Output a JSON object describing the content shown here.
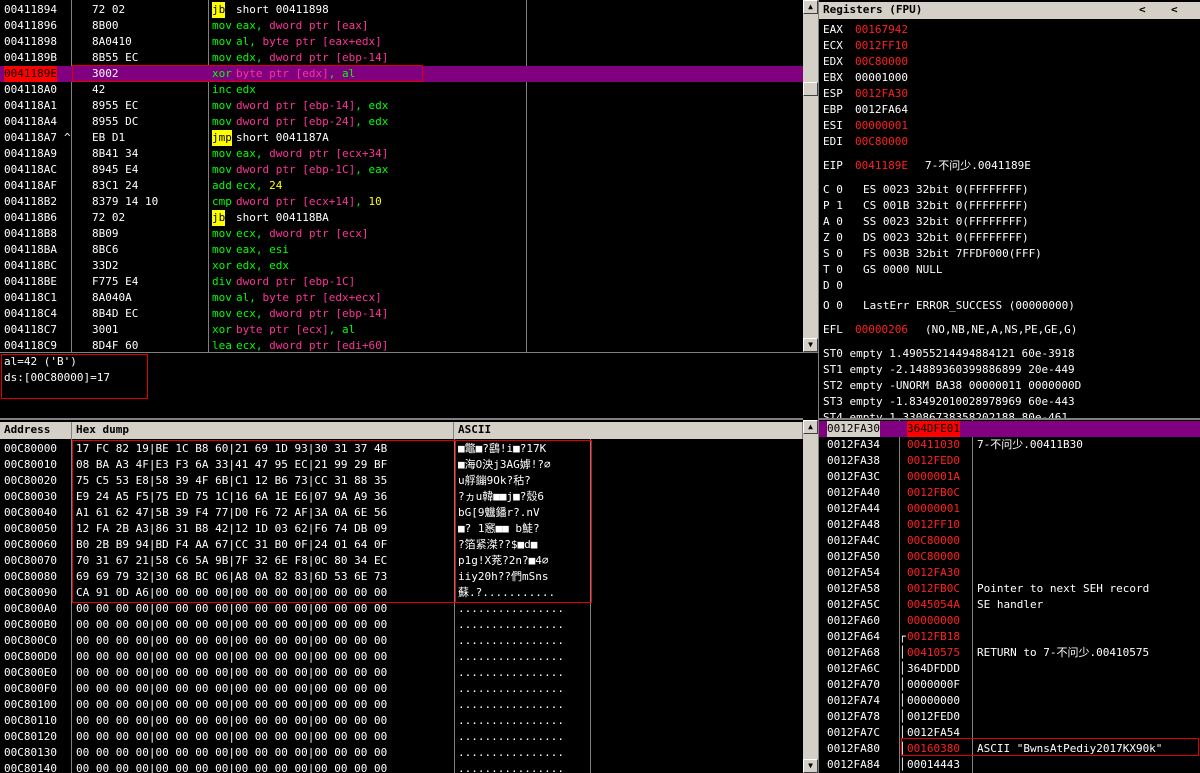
{
  "colors": {
    "background": "#000000",
    "text": "#ffffff",
    "mnemonic": "#00ff00",
    "pointer": "#ff3399",
    "highlight": "#800080",
    "changed": "#ff2020",
    "box": "#e00000"
  },
  "disasm": {
    "rows": [
      {
        "addr": "00411894",
        "mk": " ",
        "bytes": "72 02",
        "mn": "jb",
        "ops": [
          {
            "t": "short 00411898",
            "c": "w"
          }
        ]
      },
      {
        "addr": "00411896",
        "mk": " ",
        "bytes": "8B00",
        "mn": "mov",
        "ops": [
          {
            "t": "eax, ",
            "c": "g"
          },
          {
            "t": "dword ptr [eax]",
            "c": "p"
          }
        ]
      },
      {
        "addr": "00411898",
        "mk": " ",
        "bytes": "8A0410",
        "mn": "mov",
        "ops": [
          {
            "t": "al, ",
            "c": "g"
          },
          {
            "t": "byte ptr [eax+edx]",
            "c": "p"
          }
        ]
      },
      {
        "addr": "0041189B",
        "mk": " ",
        "bytes": "8B55 EC",
        "mn": "mov",
        "ops": [
          {
            "t": "edx, ",
            "c": "g"
          },
          {
            "t": "dword ptr [ebp-14]",
            "c": "p"
          }
        ]
      },
      {
        "addr": "0041189E",
        "mk": " ",
        "bytes": "3002",
        "mn": "xor",
        "ops": [
          {
            "t": "byte ptr [edx]",
            "c": "p"
          },
          {
            "t": ", al",
            "c": "g"
          }
        ]
      },
      {
        "addr": "004118A0",
        "mk": " ",
        "bytes": "42",
        "mn": "inc",
        "ops": [
          {
            "t": "edx",
            "c": "g"
          }
        ]
      },
      {
        "addr": "004118A1",
        "mk": " ",
        "bytes": "8955 EC",
        "mn": "mov",
        "ops": [
          {
            "t": "dword ptr [ebp-14]",
            "c": "p"
          },
          {
            "t": ", edx",
            "c": "g"
          }
        ]
      },
      {
        "addr": "004118A4",
        "mk": " ",
        "bytes": "8955 DC",
        "mn": "mov",
        "ops": [
          {
            "t": "dword ptr [ebp-24]",
            "c": "p"
          },
          {
            "t": ", edx",
            "c": "g"
          }
        ]
      },
      {
        "addr": "004118A7",
        "mk": "^",
        "bytes": "EB D1",
        "mn": "jmp",
        "ops": [
          {
            "t": "short 0041187A",
            "c": "w"
          }
        ]
      },
      {
        "addr": "004118A9",
        "mk": " ",
        "bytes": "8B41 34",
        "mn": "mov",
        "ops": [
          {
            "t": "eax, ",
            "c": "g"
          },
          {
            "t": "dword ptr [ecx+34]",
            "c": "p"
          }
        ]
      },
      {
        "addr": "004118AC",
        "mk": " ",
        "bytes": "8945 E4",
        "mn": "mov",
        "ops": [
          {
            "t": "dword ptr [ebp-1C]",
            "c": "p"
          },
          {
            "t": ", eax",
            "c": "g"
          }
        ]
      },
      {
        "addr": "004118AF",
        "mk": " ",
        "bytes": "83C1 24",
        "mn": "add",
        "ops": [
          {
            "t": "ecx, ",
            "c": "g"
          },
          {
            "t": "24",
            "c": "y"
          }
        ]
      },
      {
        "addr": "004118B2",
        "mk": " ",
        "bytes": "8379 14 10",
        "mn": "cmp",
        "ops": [
          {
            "t": "dword ptr [ecx+14]",
            "c": "p"
          },
          {
            "t": ", ",
            "c": "g"
          },
          {
            "t": "10",
            "c": "y"
          }
        ]
      },
      {
        "addr": "004118B6",
        "mk": " ",
        "bytes": "72 02",
        "mn": "jb",
        "ops": [
          {
            "t": "short 004118BA",
            "c": "w"
          }
        ]
      },
      {
        "addr": "004118B8",
        "mk": " ",
        "bytes": "8B09",
        "mn": "mov",
        "ops": [
          {
            "t": "ecx, ",
            "c": "g"
          },
          {
            "t": "dword ptr [ecx]",
            "c": "p"
          }
        ]
      },
      {
        "addr": "004118BA",
        "mk": " ",
        "bytes": "8BC6",
        "mn": "mov",
        "ops": [
          {
            "t": "eax, esi",
            "c": "g"
          }
        ]
      },
      {
        "addr": "004118BC",
        "mk": " ",
        "bytes": "33D2",
        "mn": "xor",
        "ops": [
          {
            "t": "edx, edx",
            "c": "g"
          }
        ]
      },
      {
        "addr": "004118BE",
        "mk": " ",
        "bytes": "F775 E4",
        "mn": "div",
        "ops": [
          {
            "t": "dword ptr [ebp-1C]",
            "c": "p"
          }
        ]
      },
      {
        "addr": "004118C1",
        "mk": " ",
        "bytes": "8A040A",
        "mn": "mov",
        "ops": [
          {
            "t": "al, ",
            "c": "g"
          },
          {
            "t": "byte ptr [edx+ecx]",
            "c": "p"
          }
        ]
      },
      {
        "addr": "004118C4",
        "mk": " ",
        "bytes": "8B4D EC",
        "mn": "mov",
        "ops": [
          {
            "t": "ecx, ",
            "c": "g"
          },
          {
            "t": "dword ptr [ebp-14]",
            "c": "p"
          }
        ]
      },
      {
        "addr": "004118C7",
        "mk": " ",
        "bytes": "3001",
        "mn": "xor",
        "ops": [
          {
            "t": "byte ptr [ecx]",
            "c": "p"
          },
          {
            "t": ", al",
            "c": "g"
          }
        ]
      },
      {
        "addr": "004118C9",
        "mk": " ",
        "bytes": "8D4F 60",
        "mn": "lea",
        "ops": [
          {
            "t": "ecx, ",
            "c": "g"
          },
          {
            "t": "dword ptr [edi+60]",
            "c": "p"
          }
        ]
      }
    ],
    "current_row": 4,
    "info_lines": [
      "al=42 ('B')",
      "ds:[00C80000]=17"
    ]
  },
  "registers": {
    "title": "Registers (FPU)",
    "nav_left": "<",
    "nav_right": "<",
    "gp": [
      {
        "name": "EAX",
        "value": "00167942",
        "changed": true
      },
      {
        "name": "ECX",
        "value": "0012FF10",
        "changed": true
      },
      {
        "name": "EDX",
        "value": "00C80000",
        "changed": true
      },
      {
        "name": "EBX",
        "value": "00001000",
        "changed": false
      },
      {
        "name": "ESP",
        "value": "0012FA30",
        "changed": true
      },
      {
        "name": "EBP",
        "value": "0012FA64",
        "changed": false
      },
      {
        "name": "ESI",
        "value": "00000001",
        "changed": true
      },
      {
        "name": "EDI",
        "value": "00C80000",
        "changed": true
      }
    ],
    "eip": {
      "name": "EIP",
      "value": "0041189E",
      "comment": "7-不问少.0041189E"
    },
    "flags": [
      {
        "f": "C 0",
        "seg": "ES 0023 32bit 0(FFFFFFFF)"
      },
      {
        "f": "P 1",
        "seg": "CS 001B 32bit 0(FFFFFFFF)"
      },
      {
        "f": "A 0",
        "seg": "SS 0023 32bit 0(FFFFFFFF)"
      },
      {
        "f": "Z 0",
        "seg": "DS 0023 32bit 0(FFFFFFFF)"
      },
      {
        "f": "S 0",
        "seg": "FS 003B 32bit 7FFDF000(FFF)"
      },
      {
        "f": "T 0",
        "seg": "GS 0000 NULL"
      },
      {
        "f": "D 0",
        "seg": ""
      },
      {
        "f": "O 0",
        "seg": "LastErr ERROR_SUCCESS (00000000)"
      }
    ],
    "efl": {
      "name": "EFL",
      "value": "00000206",
      "desc": "(NO,NB,NE,A,NS,PE,GE,G)"
    },
    "fpu": [
      "ST0 empty 1.49055214494884121 60e-3918",
      "ST1 empty -2.14889360399886899 20e-449",
      "ST2 empty -UNORM BA38 00000011 0000000D",
      "ST3 empty -1.83492010028978969 60e-443",
      "ST4 empty 1.33086738358202188 80e-461"
    ]
  },
  "dump": {
    "headers": [
      "Address",
      "Hex dump",
      "ASCII"
    ],
    "rows": [
      {
        "addr": "00C80000",
        "hex": "17 FC 82 19|BE 1C B8 60|21 69 1D 93|30 31 37 4B",
        "ascii": "■鼈■?鷂!i■?17K"
      },
      {
        "addr": "00C80010",
        "hex": "08 BA A3 4F|E3 F3 6A 33|41 47 95 EC|21 99 29 BF",
        "ascii": "■海O泱j3AG嫭!?∅"
      },
      {
        "addr": "00C80020",
        "hex": "75 C5 53 E8|58 39 4F 6B|C1 12 B6 73|CC 31 88 35",
        "ascii": "u艀鏰9Ok?秙?"
      },
      {
        "addr": "00C80030",
        "hex": "E9 24 A5 F5|75 ED 75 1C|16 6A 1E E6|07 9A A9 36",
        "ascii": "?ヵu韓■■j■?殼6"
      },
      {
        "addr": "00C80040",
        "hex": "A1 61 62 47|5B 39 F4 77|D0 F6 72 AF|3A 0A 6E 56",
        "ascii": "bG[9魕鐇r?.nV"
      },
      {
        "addr": "00C80050",
        "hex": "12 FA 2B A3|86 31 B8 42|12 1D 03 62|F6 74 DB 09",
        "ascii": "■? 1窸■■ b鯐?"
      },
      {
        "addr": "00C80060",
        "hex": "B0 2B B9 94|BD F4 AA 67|CC 31 B0 0F|24 01 64 0F",
        "ascii": "?箔紧滐??$■d■"
      },
      {
        "addr": "00C80070",
        "hex": "70 31 67 21|58 C6 5A 9B|7F 32 6E F8|0C 80 34 EC",
        "ascii": "p1g!X茺?2n?■4∅"
      },
      {
        "addr": "00C80080",
        "hex": "69 69 79 32|30 68 BC 06|A8 0A 82 83|6D 53 6E 73",
        "ascii": "iiy20h??們mSns"
      },
      {
        "addr": "00C80090",
        "hex": "CA 91 0D A6|00 00 00 00|00 00 00 00|00 00 00 00",
        "ascii": "蘇.?..........."
      },
      {
        "addr": "00C800A0",
        "hex": "00 00 00 00|00 00 00 00|00 00 00 00|00 00 00 00",
        "ascii": "................"
      },
      {
        "addr": "00C800B0",
        "hex": "00 00 00 00|00 00 00 00|00 00 00 00|00 00 00 00",
        "ascii": "................"
      },
      {
        "addr": "00C800C0",
        "hex": "00 00 00 00|00 00 00 00|00 00 00 00|00 00 00 00",
        "ascii": "................"
      },
      {
        "addr": "00C800D0",
        "hex": "00 00 00 00|00 00 00 00|00 00 00 00|00 00 00 00",
        "ascii": "................"
      },
      {
        "addr": "00C800E0",
        "hex": "00 00 00 00|00 00 00 00|00 00 00 00|00 00 00 00",
        "ascii": "................"
      },
      {
        "addr": "00C800F0",
        "hex": "00 00 00 00|00 00 00 00|00 00 00 00|00 00 00 00",
        "ascii": "................"
      },
      {
        "addr": "00C80100",
        "hex": "00 00 00 00|00 00 00 00|00 00 00 00|00 00 00 00",
        "ascii": "................"
      },
      {
        "addr": "00C80110",
        "hex": "00 00 00 00|00 00 00 00|00 00 00 00|00 00 00 00",
        "ascii": "................"
      },
      {
        "addr": "00C80120",
        "hex": "00 00 00 00|00 00 00 00|00 00 00 00|00 00 00 00",
        "ascii": "................"
      },
      {
        "addr": "00C80130",
        "hex": "00 00 00 00|00 00 00 00|00 00 00 00|00 00 00 00",
        "ascii": "................"
      },
      {
        "addr": "00C80140",
        "hex": "00 00 00 00|00 00 00 00|00 00 00 00|00 00 00 00",
        "ascii": "................"
      }
    ]
  },
  "stack": {
    "rows": [
      {
        "addr": "0012FA30",
        "value": "364DFE01",
        "comment": "",
        "value_red": false,
        "bracket": ""
      },
      {
        "addr": "0012FA34",
        "value": "00411030",
        "comment": "7-不问少.00411B30",
        "value_red": true,
        "bracket": ""
      },
      {
        "addr": "0012FA38",
        "value": "0012FED0",
        "comment": "",
        "value_red": true,
        "bracket": ""
      },
      {
        "addr": "0012FA3C",
        "value": "0000001A",
        "comment": "",
        "value_red": true,
        "bracket": ""
      },
      {
        "addr": "0012FA40",
        "value": "0012FB0C",
        "comment": "",
        "value_red": true,
        "bracket": ""
      },
      {
        "addr": "0012FA44",
        "value": "00000001",
        "comment": "",
        "value_red": true,
        "bracket": ""
      },
      {
        "addr": "0012FA48",
        "value": "0012FF10",
        "comment": "",
        "value_red": true,
        "bracket": ""
      },
      {
        "addr": "0012FA4C",
        "value": "00C80000",
        "comment": "",
        "value_red": true,
        "bracket": ""
      },
      {
        "addr": "0012FA50",
        "value": "00C80000",
        "comment": "",
        "value_red": true,
        "bracket": ""
      },
      {
        "addr": "0012FA54",
        "value": "0012FA30",
        "comment": "",
        "value_red": true,
        "bracket": ""
      },
      {
        "addr": "0012FA58",
        "value": "0012FB0C",
        "comment": "Pointer to next SEH record",
        "value_red": true,
        "bracket": ""
      },
      {
        "addr": "0012FA5C",
        "value": "0045054A",
        "comment": "SE handler",
        "value_red": true,
        "bracket": ""
      },
      {
        "addr": "0012FA60",
        "value": "00000000",
        "comment": "",
        "value_red": true,
        "bracket": ""
      },
      {
        "addr": "0012FA64",
        "value": "0012FB18",
        "comment": "",
        "value_red": true,
        "bracket": "top"
      },
      {
        "addr": "0012FA68",
        "value": "00410575",
        "comment": "RETURN to 7-不问少.00410575",
        "value_red": true,
        "bracket": "mid"
      },
      {
        "addr": "0012FA6C",
        "value": "364DFDDD",
        "comment": "",
        "value_red": false,
        "bracket": "mid"
      },
      {
        "addr": "0012FA70",
        "value": "0000000F",
        "comment": "",
        "value_red": false,
        "bracket": "mid"
      },
      {
        "addr": "0012FA74",
        "value": "00000000",
        "comment": "",
        "value_red": false,
        "bracket": "mid"
      },
      {
        "addr": "0012FA78",
        "value": "0012FED0",
        "comment": "",
        "value_red": false,
        "bracket": "mid"
      },
      {
        "addr": "0012FA7C",
        "value": "0012FA54",
        "comment": "",
        "value_red": false,
        "bracket": "mid"
      },
      {
        "addr": "0012FA80",
        "value": "00160380",
        "comment": "ASCII \"BwnsAtPediy2017KX90k\"",
        "value_red": true,
        "bracket": "mid"
      },
      {
        "addr": "0012FA84",
        "value": "00014443",
        "comment": "",
        "value_red": false,
        "bracket": "mid"
      }
    ]
  }
}
